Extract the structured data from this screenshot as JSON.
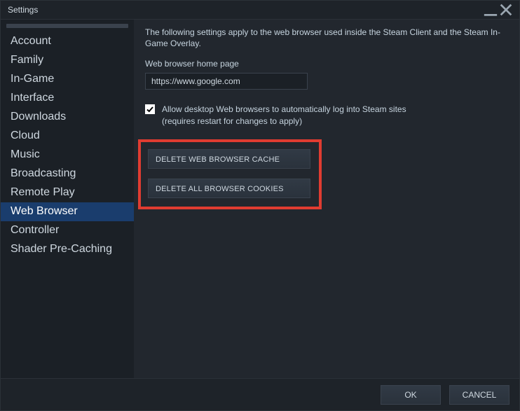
{
  "window": {
    "title": "Settings"
  },
  "sidebar": {
    "items": [
      {
        "label": "Account"
      },
      {
        "label": "Family"
      },
      {
        "label": "In-Game"
      },
      {
        "label": "Interface"
      },
      {
        "label": "Downloads"
      },
      {
        "label": "Cloud"
      },
      {
        "label": "Music"
      },
      {
        "label": "Broadcasting"
      },
      {
        "label": "Remote Play"
      },
      {
        "label": "Web Browser"
      },
      {
        "label": "Controller"
      },
      {
        "label": "Shader Pre-Caching"
      }
    ],
    "active_index": 9
  },
  "main": {
    "description": "The following settings apply to the web browser used inside the Steam Client and the Steam In-Game Overlay.",
    "homepage_label": "Web browser home page",
    "homepage_value": "https://www.google.com",
    "checkbox_checked": true,
    "checkbox_line1": "Allow desktop Web browsers to automatically log into Steam sites",
    "checkbox_line2": "(requires restart for changes to apply)",
    "delete_cache_label": "DELETE WEB BROWSER CACHE",
    "delete_cookies_label": "DELETE ALL BROWSER COOKIES"
  },
  "footer": {
    "ok_label": "OK",
    "cancel_label": "CANCEL"
  },
  "colors": {
    "highlight": "#e03c31",
    "bg_dark": "#1e2329",
    "bg_panel": "#22272e",
    "accent_active": "#1a3d6d"
  }
}
